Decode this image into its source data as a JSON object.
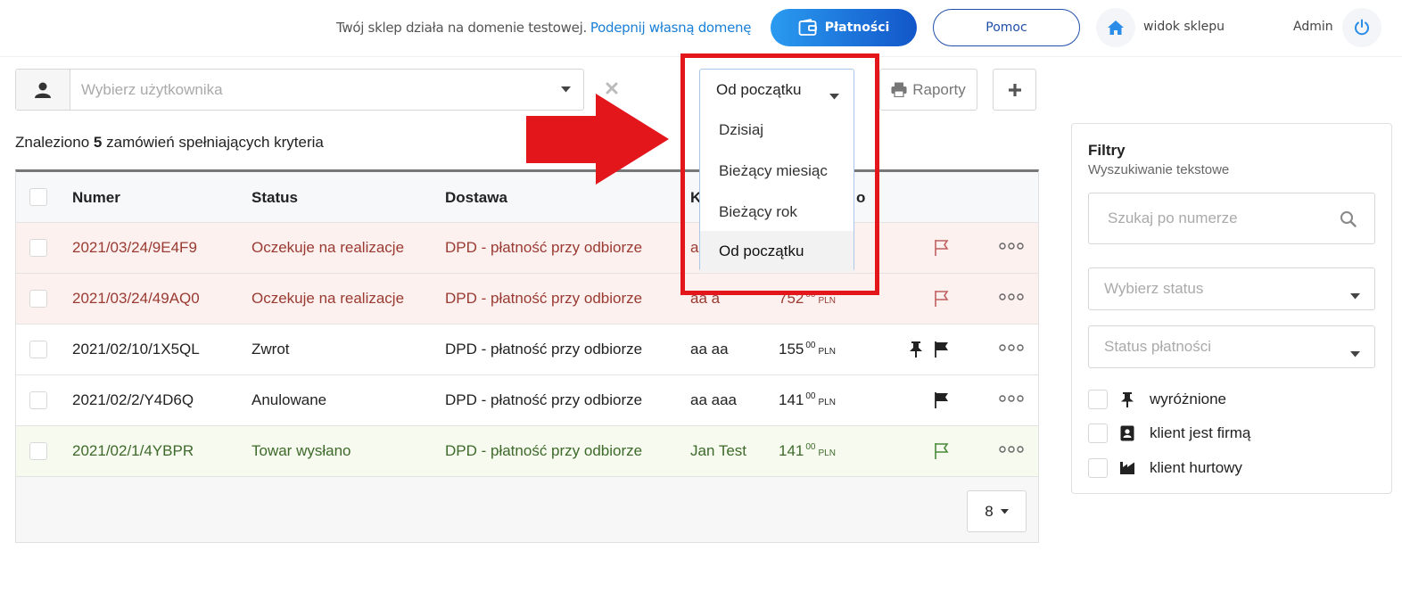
{
  "topbar": {
    "domain_text": "Twój sklep działa na domenie testowej.",
    "domain_link": "Podepnij własną domenę",
    "payments_label": "Płatności",
    "help_label": "Pomoc",
    "shop_view_label": "widok sklepu",
    "admin_label": "Admin"
  },
  "toolbar": {
    "user_placeholder": "Wybierz użytkownika",
    "range_value": "Od początku",
    "reports_label": "Raporty"
  },
  "results": {
    "prefix": "Znaleziono",
    "count": "5",
    "suffix": "zamówień spełniających kryteria"
  },
  "table": {
    "headers": {
      "number": "Numer",
      "status": "Status",
      "delivery": "Dostawa",
      "client_partial": "K",
      "amount_partial": "o"
    },
    "rows": [
      {
        "number": "2021/03/24/9E4F9",
        "status": "Oczekuje na realizacje",
        "delivery": "DPD - płatność przy odbiorze",
        "client": "aa",
        "amount": "",
        "cents": "",
        "currency": ""
      },
      {
        "number": "2021/03/24/49AQ0",
        "status": "Oczekuje na realizacje",
        "delivery": "DPD - płatność przy odbiorze",
        "client": "aa a",
        "amount": "752",
        "cents": "00",
        "currency": "PLN"
      },
      {
        "number": "2021/02/10/1X5QL",
        "status": "Zwrot",
        "delivery": "DPD - płatność przy odbiorze",
        "client": "aa aa",
        "amount": "155",
        "cents": "00",
        "currency": "PLN"
      },
      {
        "number": "2021/02/2/Y4D6Q",
        "status": "Anulowane",
        "delivery": "DPD - płatność przy odbiorze",
        "client": "aa aaa",
        "amount": "141",
        "cents": "00",
        "currency": "PLN"
      },
      {
        "number": "2021/02/1/4YBPR",
        "status": "Towar wysłano",
        "delivery": "DPD - płatność przy odbiorze",
        "client": "Jan Test",
        "amount": "141",
        "cents": "00",
        "currency": "PLN"
      }
    ],
    "page_size": "8"
  },
  "dropdown": {
    "options": [
      "Dzisiaj",
      "Bieżący miesiąc",
      "Bieżący rok",
      "Od początku"
    ],
    "selected": "Od początku"
  },
  "filters": {
    "title": "Filtry",
    "subtitle": "Wyszukiwanie tekstowe",
    "search_placeholder": "Szukaj po numerze",
    "status_placeholder": "Wybierz status",
    "payment_placeholder": "Status płatności",
    "checks": [
      "wyróżnione",
      "klient jest firmą",
      "klient hurtowy"
    ]
  },
  "colors": {
    "accent": "#1a7fd6",
    "highlight": "#e3161c",
    "pending_text": "#9a3a32",
    "sent_text": "#3d6a2a"
  }
}
